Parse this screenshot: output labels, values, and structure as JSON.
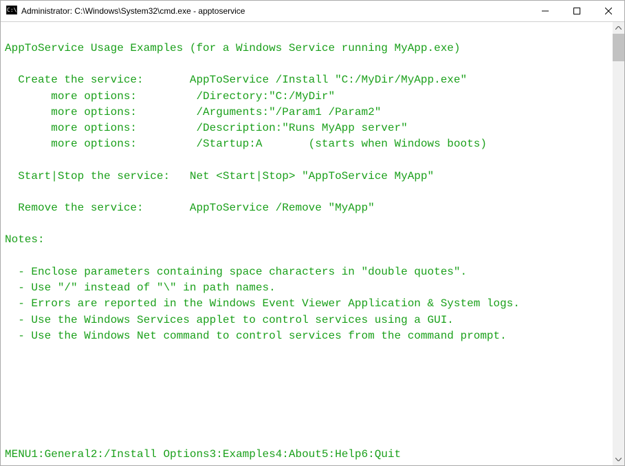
{
  "window": {
    "title": "Administrator: C:\\Windows\\System32\\cmd.exe - apptoservice"
  },
  "terminal": {
    "lines": [
      "",
      "AppToService Usage Examples (for a Windows Service running MyApp.exe)",
      "",
      "  Create the service:       AppToService /Install \"C:/MyDir/MyApp.exe\"",
      "       more options:         /Directory:\"C:/MyDir\"",
      "       more options:         /Arguments:\"/Param1 /Param2\"",
      "       more options:         /Description:\"Runs MyApp server\"",
      "       more options:         /Startup:A       (starts when Windows boots)",
      "",
      "  Start|Stop the service:   Net <Start|Stop> \"AppToService MyApp\"",
      "",
      "  Remove the service:       AppToService /Remove \"MyApp\"",
      "",
      "Notes:",
      "",
      "  - Enclose parameters containing space characters in \"double quotes\".",
      "  - Use \"/\" instead of \"\\\" in path names.",
      "  - Errors are reported in the Windows Event Viewer Application & System logs.",
      "  - Use the Windows Services applet to control services using a GUI.",
      "  - Use the Windows Net command to control services from the command prompt."
    ]
  },
  "menu": {
    "label": "MENU",
    "items": [
      "1:General",
      "2:/Install Options",
      "3:Examples",
      "4:About",
      "5:Help",
      "6:Quit"
    ]
  }
}
